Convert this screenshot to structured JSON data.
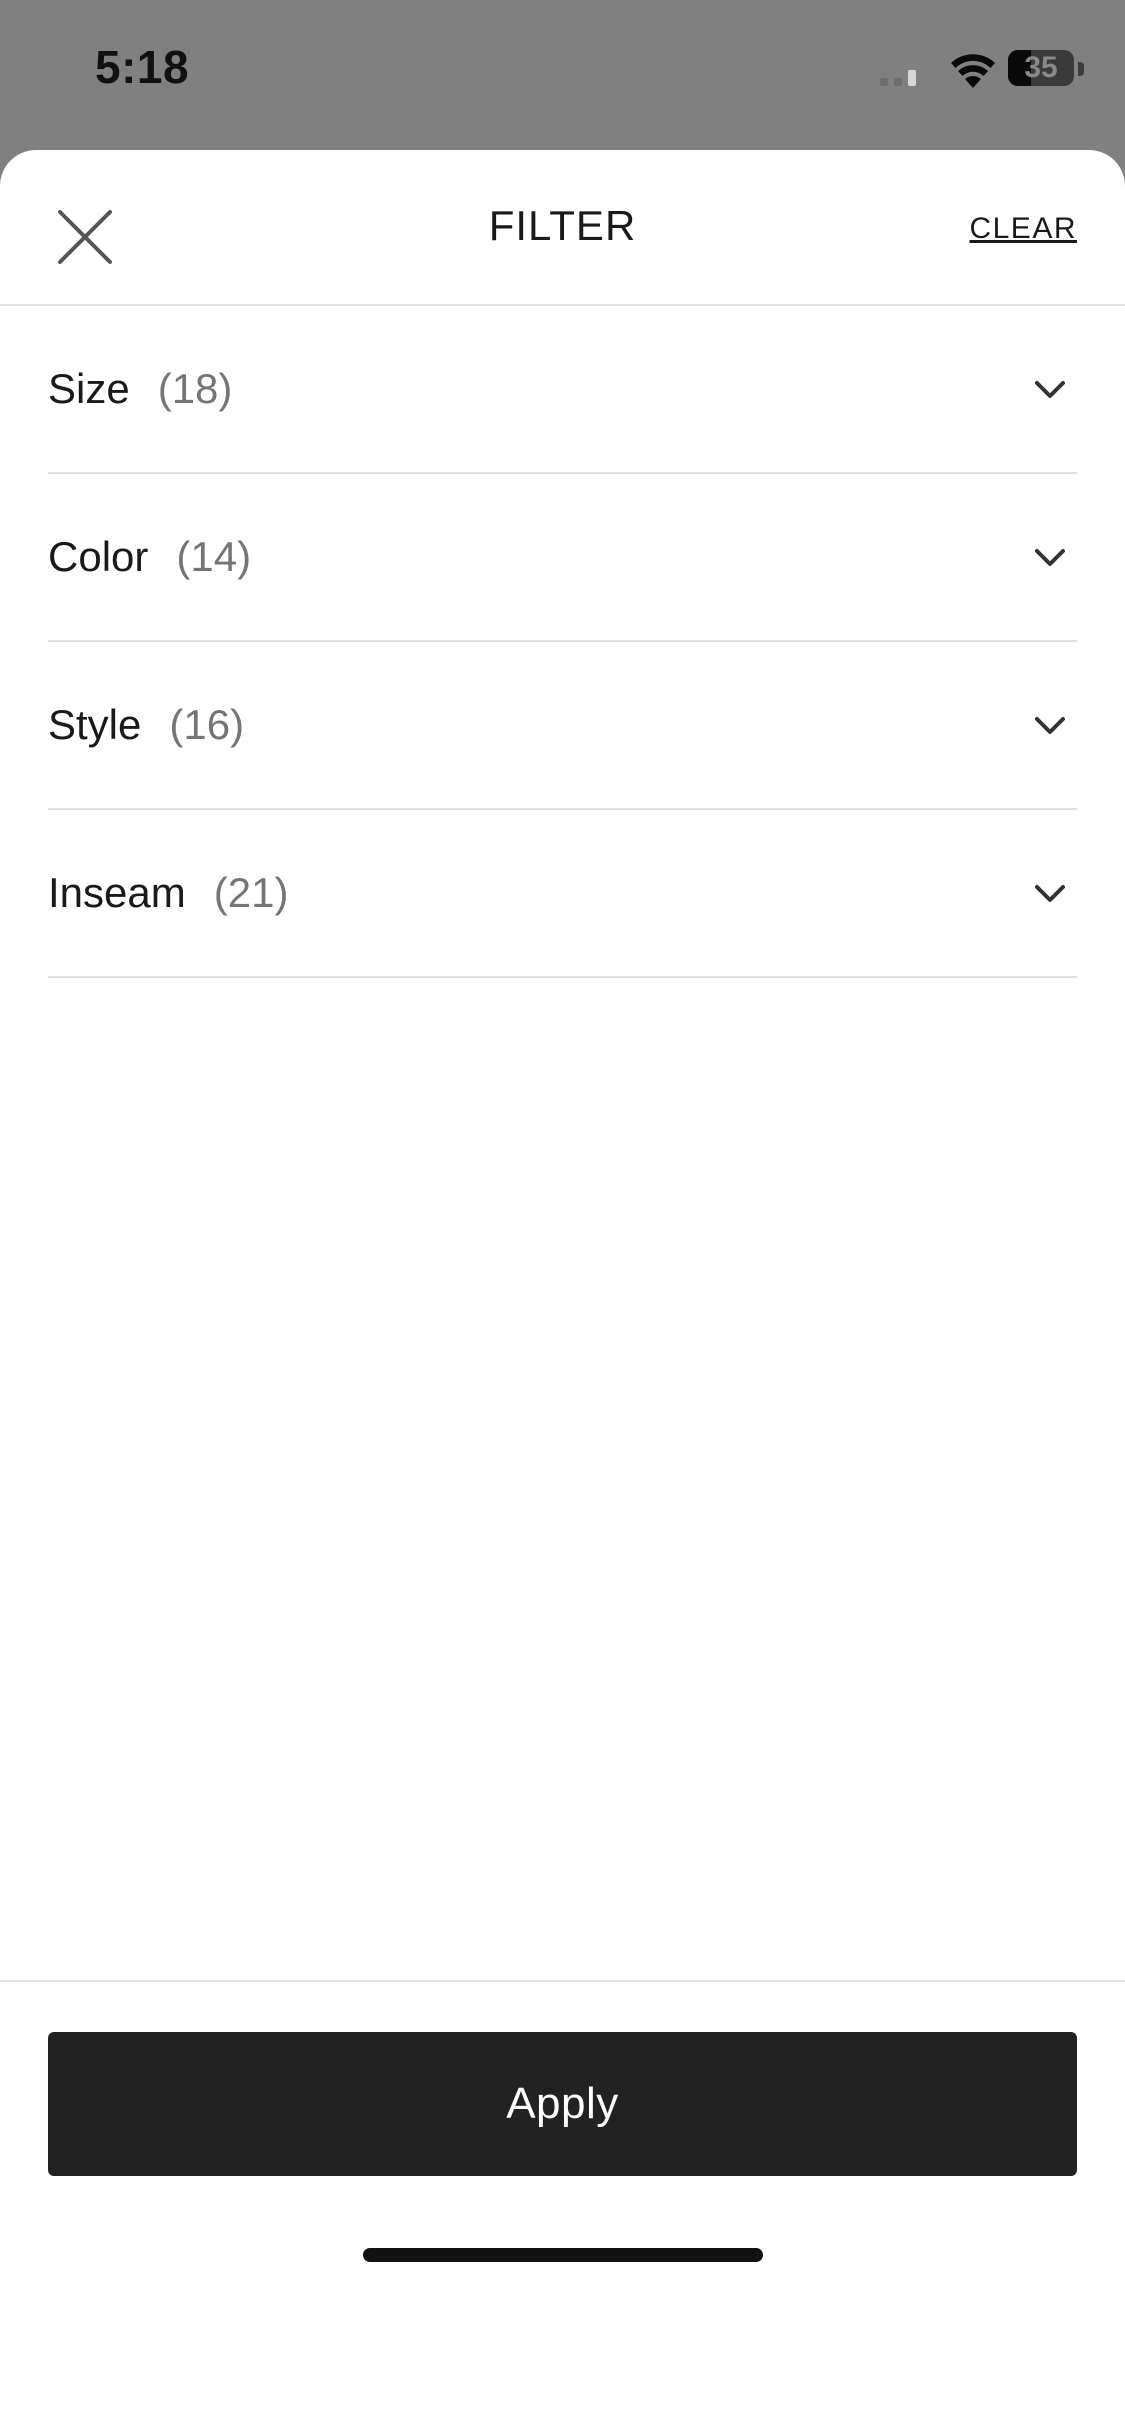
{
  "status_bar": {
    "time": "5:18",
    "battery_level": "35",
    "battery_fraction": 0.35
  },
  "header": {
    "title": "FILTER",
    "clear_label": "CLEAR",
    "close_icon": "close-icon"
  },
  "filters": [
    {
      "name": "Size",
      "count": "(18)"
    },
    {
      "name": "Color",
      "count": "(14)"
    },
    {
      "name": "Style",
      "count": "(16)"
    },
    {
      "name": "Inseam",
      "count": "(21)"
    }
  ],
  "footer": {
    "apply_label": "Apply"
  },
  "colors": {
    "overlay": "#808080",
    "sheet": "#ffffff",
    "apply_button": "#222222",
    "divider": "#e2e2e2",
    "count_text": "#757575"
  }
}
